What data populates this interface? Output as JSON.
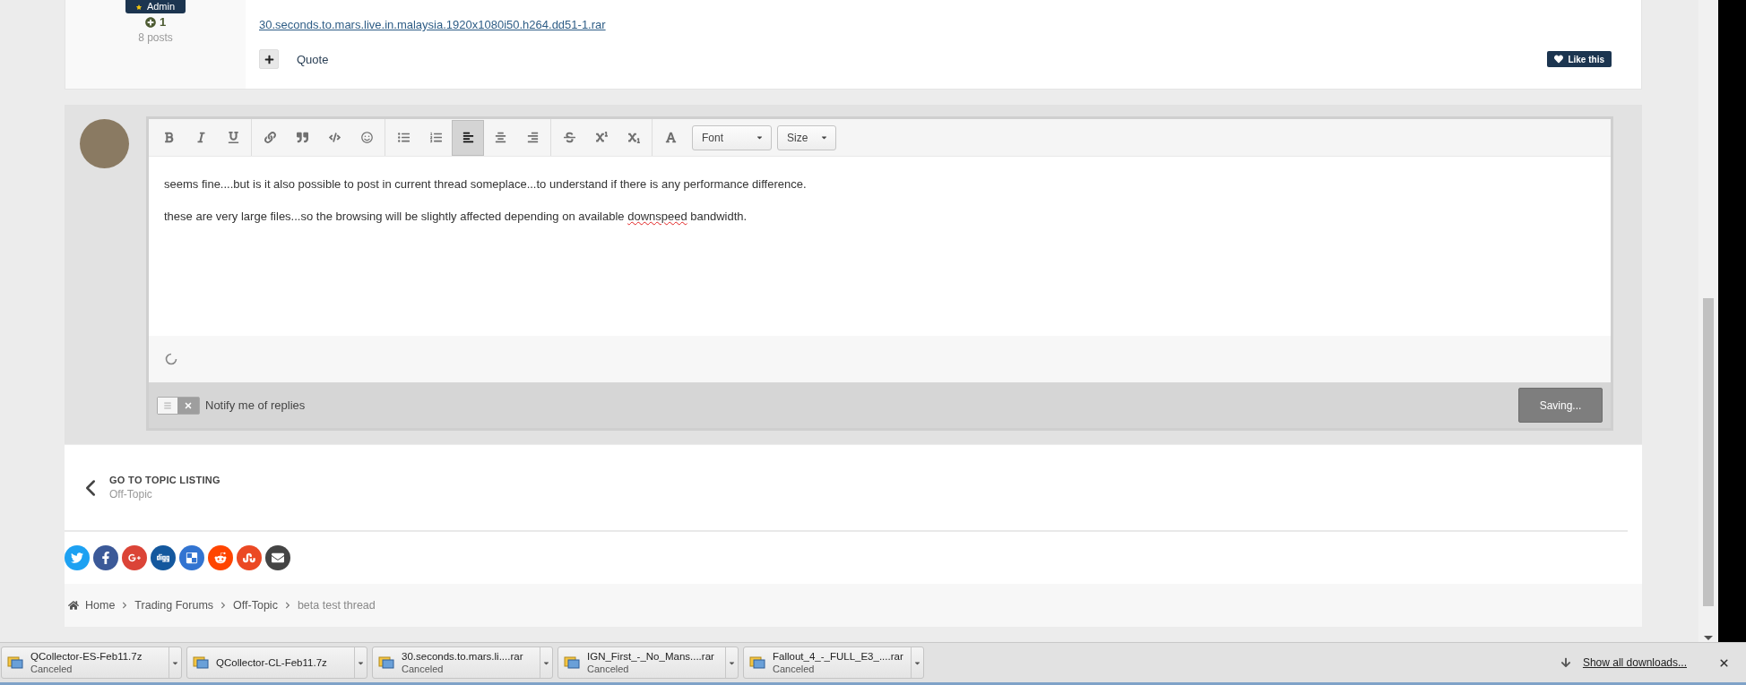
{
  "post": {
    "author_badge": "Admin",
    "reputation": "1",
    "post_count": "8 posts",
    "attachment_link": "30.seconds.to.mars.live.in.malaysia.1920x1080i50.h264.dd51-1.rar",
    "quote_label": "Quote",
    "like_label": "Like this"
  },
  "editor": {
    "toolbar": [
      [
        {
          "kind": "bold",
          "selected": false
        },
        {
          "kind": "italic",
          "selected": false
        },
        {
          "kind": "underline",
          "selected": false
        }
      ],
      [
        {
          "kind": "link",
          "selected": false
        },
        {
          "kind": "quote",
          "selected": false
        },
        {
          "kind": "code",
          "selected": false
        },
        {
          "kind": "emoji",
          "selected": false
        }
      ],
      [
        {
          "kind": "bullets",
          "selected": false
        },
        {
          "kind": "numbers",
          "selected": false
        },
        {
          "kind": "align_left",
          "selected": true
        },
        {
          "kind": "align_center",
          "selected": false
        },
        {
          "kind": "align_right",
          "selected": false
        }
      ],
      [
        {
          "kind": "strike",
          "selected": false
        },
        {
          "kind": "superscript",
          "selected": false
        },
        {
          "kind": "subscript",
          "selected": false
        }
      ],
      [
        {
          "kind": "text_color",
          "selected": false
        },
        {
          "kind": "dropdown",
          "label": "Font"
        },
        {
          "kind": "dropdown",
          "label": "Size"
        }
      ]
    ],
    "paragraphs": [
      [
        {
          "text": "seems fine....but is it also possible to post in current thread someplace...to understand if there is any performance difference.",
          "misspelled": false
        }
      ],
      [
        {
          "text": "these are very large files...so the browsing will be slightly affected depending on available ",
          "misspelled": false
        },
        {
          "text": "downspeed",
          "misspelled": true
        },
        {
          "text": " bandwidth.",
          "misspelled": false
        }
      ]
    ],
    "loading": true,
    "notify": {
      "label": "Notify me of replies",
      "on": false
    },
    "submit_label": "Saving..."
  },
  "topic_nav": {
    "title": "GO TO TOPIC LISTING",
    "forum": "Off-Topic"
  },
  "share": [
    {
      "kind": "twitter",
      "color": "#1da1f2"
    },
    {
      "kind": "facebook",
      "color": "#3b5998"
    },
    {
      "kind": "googleplus",
      "color": "#db4437"
    },
    {
      "kind": "digg",
      "color": "#14589e"
    },
    {
      "kind": "delicious",
      "color": "#3274d1"
    },
    {
      "kind": "reddit",
      "color": "#ff4500"
    },
    {
      "kind": "stumbleupon",
      "color": "#eb4924"
    },
    {
      "kind": "email",
      "color": "#444444"
    }
  ],
  "breadcrumb": [
    "Home",
    "Trading Forums",
    "Off-Topic",
    "beta test thread"
  ],
  "downloads": [
    {
      "name": "QCollector-ES-Feb11.7z",
      "status": "Canceled"
    },
    {
      "name": "QCollector-CL-Feb11.7z"
    },
    {
      "name": "30.seconds.to.mars.li....rar",
      "status": "Canceled"
    },
    {
      "name": "IGN_First_-_No_Mans....rar",
      "status": "Canceled"
    },
    {
      "name": "Fallout_4_-_FULL_E3_....rar",
      "status": "Canceled"
    }
  ],
  "show_all_label": "Show all downloads..."
}
